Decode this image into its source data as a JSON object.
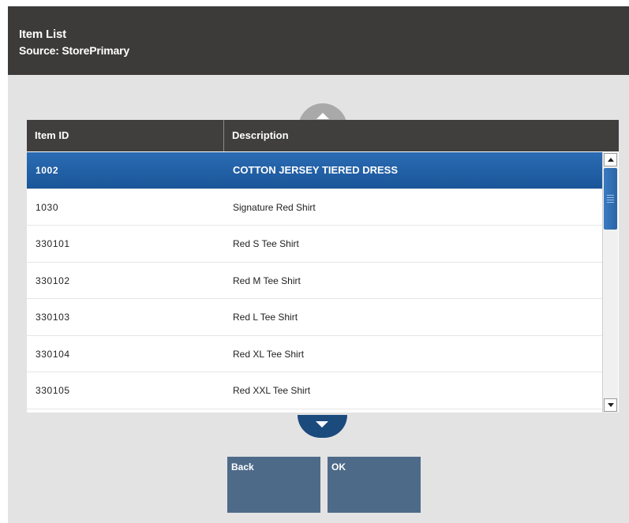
{
  "header": {
    "title": "Item List",
    "subtitle": "Source: StorePrimary"
  },
  "table": {
    "columns": [
      "Item ID",
      "Description"
    ],
    "rows": [
      {
        "id": "1002",
        "description": "COTTON JERSEY TIERED DRESS",
        "selected": true
      },
      {
        "id": "1030",
        "description": "Signature Red Shirt"
      },
      {
        "id": "330101",
        "description": "Red S Tee Shirt"
      },
      {
        "id": "330102",
        "description": "Red M Tee Shirt"
      },
      {
        "id": "330103",
        "description": "Red L Tee Shirt"
      },
      {
        "id": "330104",
        "description": "Red XL Tee Shirt"
      },
      {
        "id": "330105",
        "description": "Red XXL Tee Shirt"
      }
    ]
  },
  "icons": {
    "scroll_up": "chevron-up-icon",
    "scroll_down": "chevron-down-icon"
  },
  "buttons": {
    "back_label": "Back",
    "ok_label": "OK"
  },
  "colors": {
    "header_bg": "#3c3b3a",
    "selection": "#1f5ea3",
    "button_bg": "#4e6a89",
    "page_bg": "#e3e3e3"
  }
}
